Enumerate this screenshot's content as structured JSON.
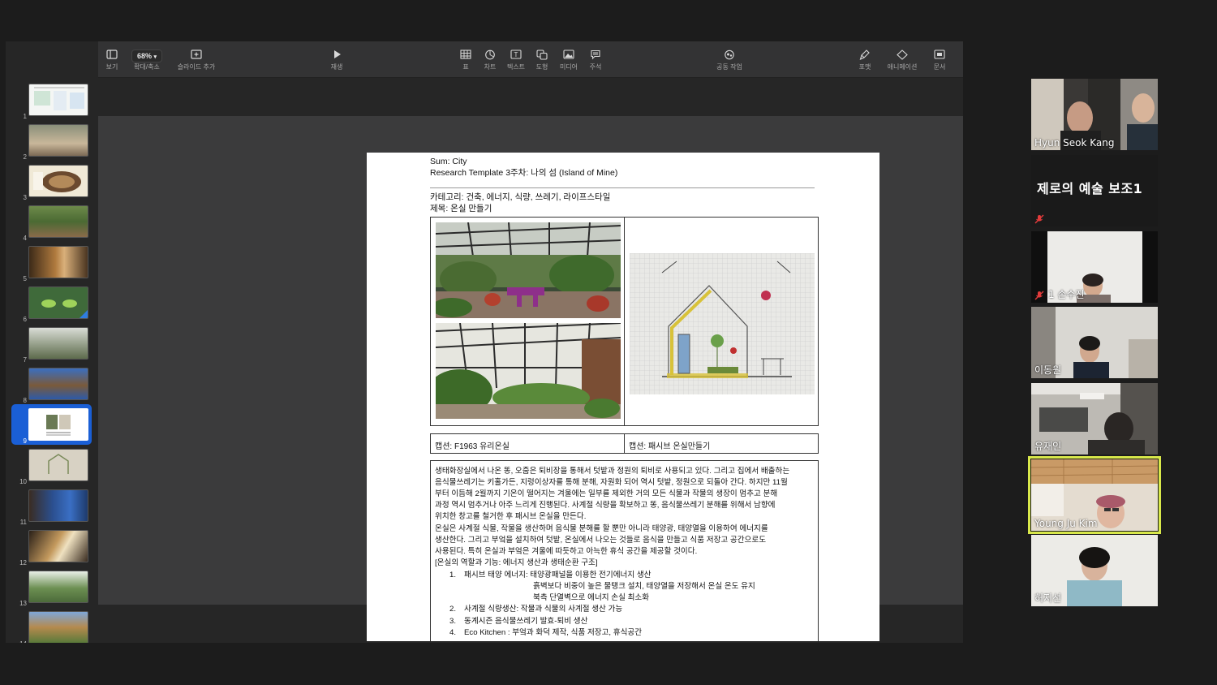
{
  "toolbar": {
    "view": "보기",
    "zoom_value": "68%",
    "zoom": "확대/축소",
    "add_slide": "슬라이드 추가",
    "play": "재생",
    "table": "표",
    "chart": "차트",
    "text": "텍스트",
    "shape": "도형",
    "media": "미디어",
    "comment": "주석",
    "collaborate": "공동 작업",
    "format": "포맷",
    "animate": "애니메이션",
    "document": "문서"
  },
  "slides": [
    {
      "num": "1"
    },
    {
      "num": "2"
    },
    {
      "num": "3"
    },
    {
      "num": "4"
    },
    {
      "num": "5"
    },
    {
      "num": "6"
    },
    {
      "num": "7"
    },
    {
      "num": "8"
    },
    {
      "num": "9",
      "selected": true
    },
    {
      "num": "10"
    },
    {
      "num": "11"
    },
    {
      "num": "12"
    },
    {
      "num": "13"
    },
    {
      "num": "14"
    }
  ],
  "slide": {
    "title1": "Sum: City",
    "title2": "Research Template 3주차: 나의 섬 (Island of Mine)",
    "category": "카테고리: 건축, 에너지, 식량, 쓰레기, 라이프스타일",
    "subject": "제목: 온실 만들기",
    "caption_left": "캡션: F1963 유리온실",
    "caption_right": "캡션: 패시브 온실만들기",
    "desc": [
      "생태화장실에서 나온 똥, 오줌은 퇴비장을 통해서 텃밭과 정원의 퇴비로 사용되고 있다. 그리고 집에서 배출하는",
      "음식물쓰레기는 키홀가든, 지렁이상자를 통해 분해, 자원화 되어 역시 텃밭, 정원으로 되돌아 간다. 하지만 11월",
      "부터 이듬해 2월까지 기온이 떨어지는 겨울에는 일부를 제외한 거의 모든 식물과 작물의 생장이 멈추고 분해",
      "과정 역시 멈추거나 아주 느리게 진행된다. 사계절 식량을 확보하고 똥, 음식물쓰레기 분해를 위해서 남향에",
      "위치한 창고를 철거한 후 패시브 온실을 만든다.",
      "온실은 사계절 식물, 작물을 생산하며 음식물 분해를 할 뿐만 아니라 태양광, 태양열을 이용하여 에너지를",
      "생산한다. 그리고 부엌을 설치하여 텃밭, 온실에서 나오는 것들로 음식을 만들고 식품 저장고 공간으로도",
      "사용된다. 특히 온실과 부엌은 겨울에 따듯하고 아늑한 휴식 공간을 제공할 것이다.",
      "[온실의 역할과 기능: 에너지 생산과 생태순환 구조]"
    ],
    "list": [
      {
        "n": "1.",
        "t": "패시브 태양 에너지: 태양광패널을 이용한 전기에너지 생산"
      },
      {
        "n": "",
        "t": "흙벽보다 비중이 높은 물탱크 설치, 태양열을 저장해서 온실 온도 유지"
      },
      {
        "n": "",
        "t": "북측 단열벽으로 에너지 손실 최소화"
      },
      {
        "n": "2.",
        "t": "사계절 식량생산: 작물과 식물의 사계절 생산 가능"
      },
      {
        "n": "3.",
        "t": "동계시즌 음식물쓰레기 발효-퇴비 생산"
      },
      {
        "n": "4.",
        "t": "Eco Kitchen : 부엌과 화덕 제작, 식품 저장고, 휴식공간"
      }
    ]
  },
  "participants": {
    "p1": "Hyun Seok Kang",
    "p2": "제로의 예술 보조1",
    "p3": "1 손수진",
    "p4": "이동원",
    "p5": "유재인",
    "p6": "Young Ju Kim",
    "p7": "허지선"
  }
}
